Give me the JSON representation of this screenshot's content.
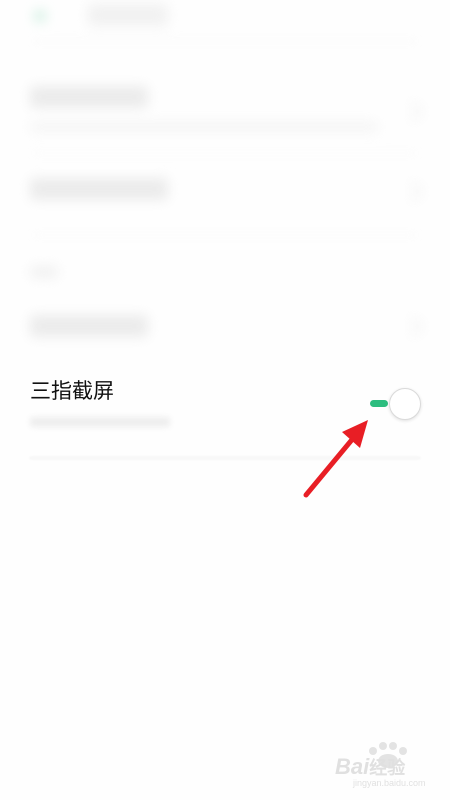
{
  "settings": {
    "three_finger_screenshot": {
      "label": "三指截屏",
      "enabled": true
    }
  },
  "colors": {
    "accent_green": "#2dbd7f",
    "annotation_red": "#e81e25"
  },
  "watermark": {
    "brand": "Bai",
    "brand_suffix": "经验",
    "url": "jingyan.baidu.com"
  }
}
